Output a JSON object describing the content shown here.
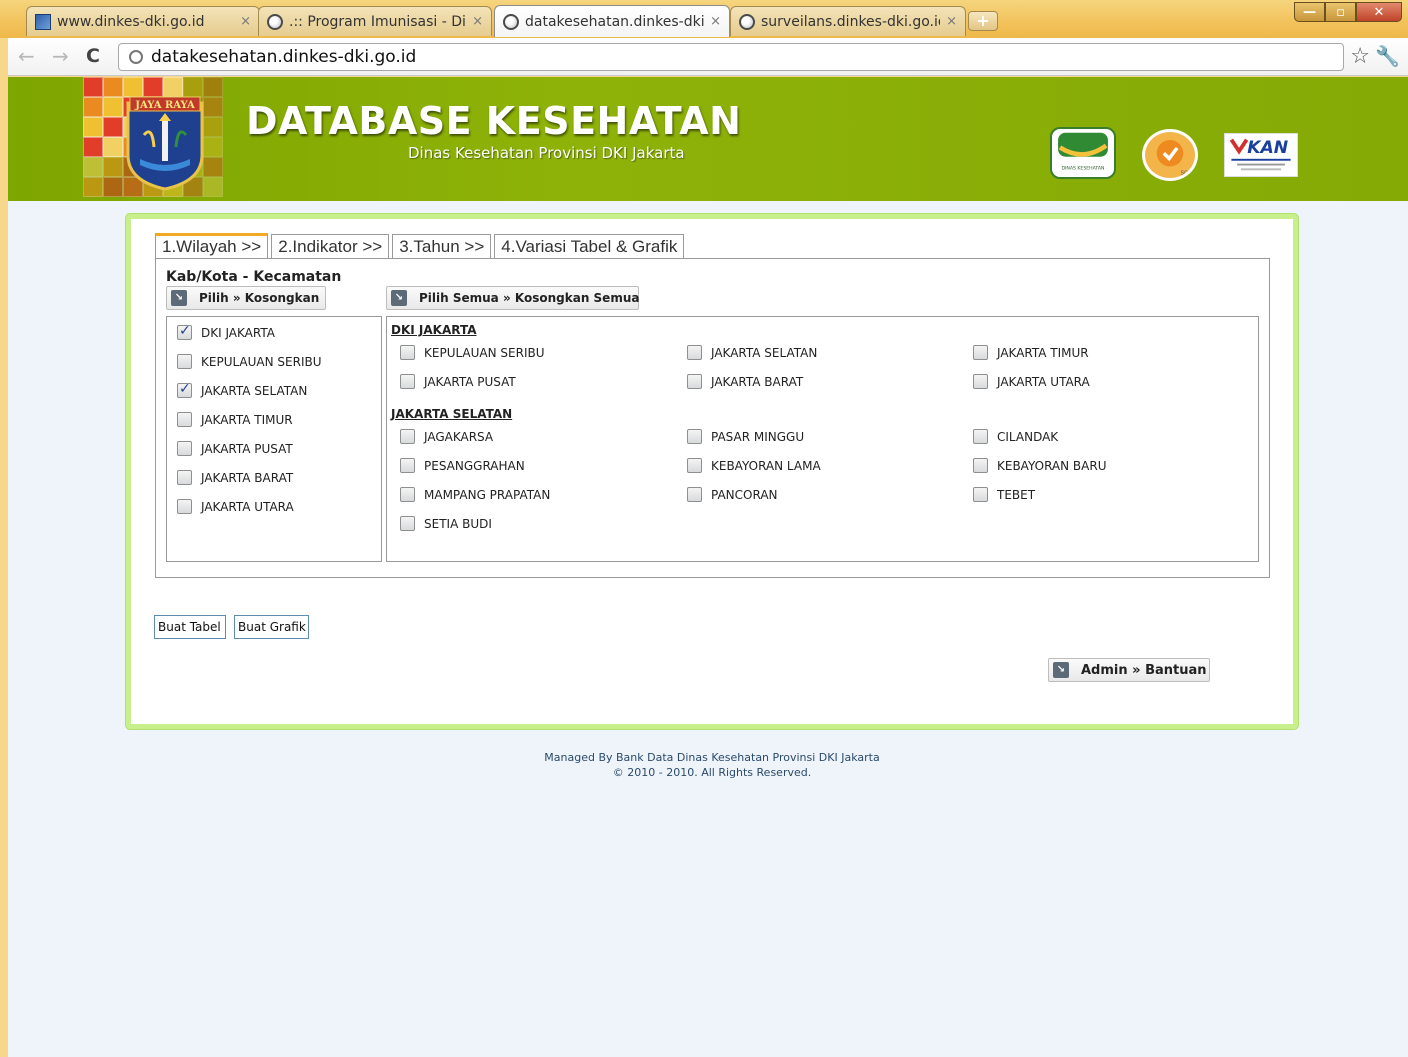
{
  "browser": {
    "tabs": [
      {
        "label": "www.dinkes-dki.go.id",
        "icon": "site-favicon-icon"
      },
      {
        "label": ".:: Program Imunisasi - Dinas",
        "icon": "globe-icon"
      },
      {
        "label": "datakesehatan.dinkes-dki.go",
        "icon": "globe-icon",
        "active": true
      },
      {
        "label": "surveilans.dinkes-dki.go.id",
        "icon": "globe-icon"
      }
    ],
    "close_glyph": "×",
    "new_tab_glyph": "+",
    "url": "datakesehatan.dinkes-dki.go.id"
  },
  "header": {
    "emblem_text": "JAYA RAYA",
    "title": "DATABASE KESEHATAN",
    "subtitle": "Dinas Kesehatan Provinsi DKI Jakarta",
    "logos": [
      "DINAS KESEHATAN",
      "SGS",
      "KAN"
    ]
  },
  "wizard_tabs": [
    "1.Wilayah >>",
    "2.Indikator >>",
    "3.Tahun >>",
    "4.Variasi Tabel & Grafik"
  ],
  "wilayah": {
    "section_title": "Kab/Kota - Kecamatan",
    "pilih_button": "Pilih » Kosongkan",
    "pilih_semua_button": "Pilih Semua » Kosongkan Semua",
    "kab_kota": [
      {
        "label": "DKI JAKARTA",
        "checked": true
      },
      {
        "label": "KEPULAUAN SERIBU",
        "checked": false
      },
      {
        "label": "JAKARTA SELATAN",
        "checked": true
      },
      {
        "label": "JAKARTA TIMUR",
        "checked": false
      },
      {
        "label": "JAKARTA PUSAT",
        "checked": false
      },
      {
        "label": "JAKARTA BARAT",
        "checked": false
      },
      {
        "label": "JAKARTA UTARA",
        "checked": false
      }
    ],
    "groups": [
      {
        "title": "DKI JAKARTA",
        "items": [
          "KEPULAUAN SERIBU",
          "JAKARTA SELATAN",
          "JAKARTA TIMUR",
          "JAKARTA PUSAT",
          "JAKARTA BARAT",
          "JAKARTA UTARA"
        ]
      },
      {
        "title": "JAKARTA SELATAN",
        "items": [
          "JAGAKARSA",
          "PASAR MINGGU",
          "CILANDAK",
          "PESANGGRAHAN",
          "KEBAYORAN LAMA",
          "KEBAYORAN BARU",
          "MAMPANG PRAPATAN",
          "PANCORAN",
          "TEBET",
          "SETIA BUDI"
        ]
      }
    ]
  },
  "actions": {
    "buat_tabel": "Buat Tabel",
    "buat_grafik": "Buat Grafik",
    "admin_bantuan": "Admin » Bantuan"
  },
  "footer": {
    "line1": "Managed By Bank Data Dinas Kesehatan Provinsi DKI Jakarta",
    "line2": "© 2010 - 2010. All Rights Reserved."
  },
  "colors": {
    "header_green": "#8eb208",
    "panel_border": "#c7ef8c",
    "active_tab_accent": "#f2a928",
    "page_bg": "#eef4fa"
  }
}
